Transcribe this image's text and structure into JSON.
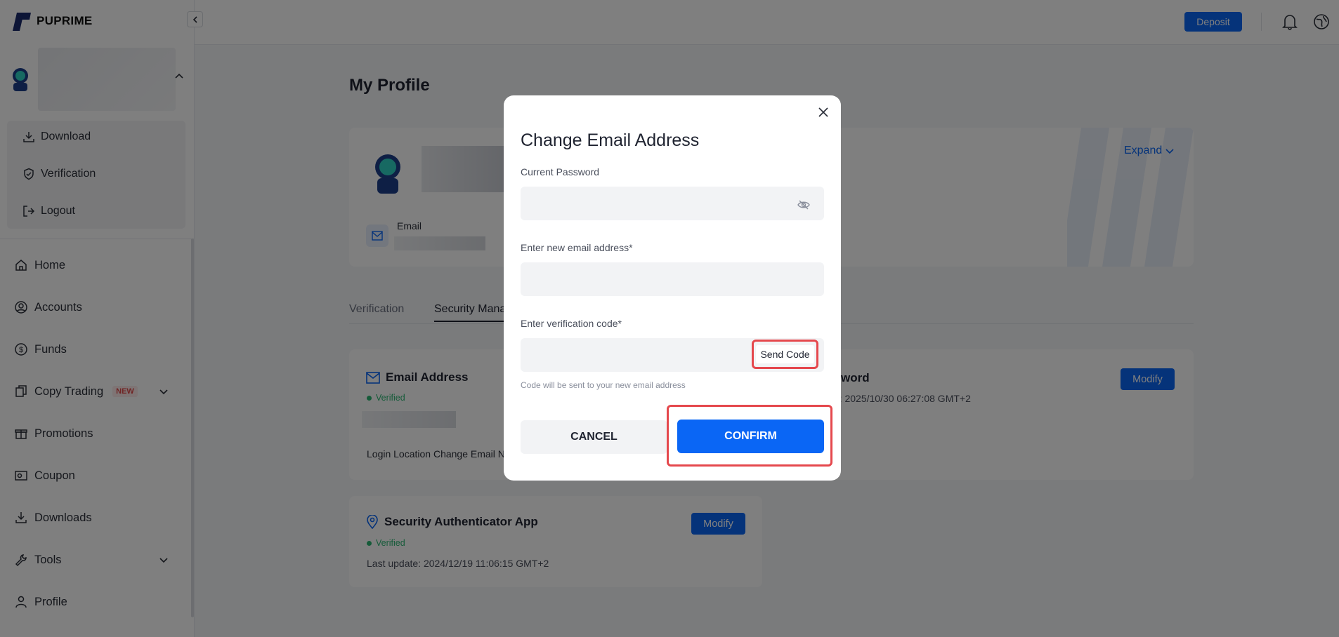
{
  "brand": {
    "name": "PUPRIME",
    "accent": "#0a66f5"
  },
  "topbar": {
    "deposit_label": "Deposit"
  },
  "user_menu": {
    "items": [
      {
        "label": "Download",
        "icon": "download-icon"
      },
      {
        "label": "Verification",
        "icon": "shield-check-icon"
      },
      {
        "label": "Logout",
        "icon": "logout-icon"
      }
    ]
  },
  "sidebar": {
    "items": [
      {
        "label": "Home",
        "icon": "home-icon"
      },
      {
        "label": "Accounts",
        "icon": "user-circle-icon"
      },
      {
        "label": "Funds",
        "icon": "dollar-icon"
      },
      {
        "label": "Copy Trading",
        "icon": "copy-icon",
        "badge": "NEW",
        "has_submenu": true
      },
      {
        "label": "Promotions",
        "icon": "gift-icon"
      },
      {
        "label": "Coupon",
        "icon": "coupon-icon"
      },
      {
        "label": "Downloads",
        "icon": "download-icon"
      },
      {
        "label": "Tools",
        "icon": "wrench-icon",
        "has_submenu": true
      },
      {
        "label": "Profile",
        "icon": "person-icon"
      }
    ]
  },
  "page": {
    "title": "My Profile",
    "expand_label": "Expand",
    "email_label": "Email",
    "tabs": [
      {
        "label": "Verification",
        "active": false
      },
      {
        "label": "Security Mana",
        "active": true
      }
    ],
    "email_card": {
      "title": "Email Address",
      "status": "Verified",
      "footer": "Login Location Change Email N"
    },
    "password_card": {
      "title_fragment": "word",
      "last_update_fragment": "te: 2025/10/30 06:27:08 GMT+2",
      "modify_label": "Modify"
    },
    "authenticator_card": {
      "title": "Security Authenticator App",
      "status": "Verified",
      "last_update": "Last update: 2024/12/19 11:06:15 GMT+2",
      "modify_label": "Modify"
    }
  },
  "modal": {
    "title": "Change Email Address",
    "current_password_label": "Current Password",
    "new_email_label": "Enter new email address*",
    "verification_label": "Enter verification code*",
    "send_code_label": "Send Code",
    "hint": "Code will be sent to your new email address",
    "cancel_label": "CANCEL",
    "confirm_label": "CONFIRM"
  }
}
